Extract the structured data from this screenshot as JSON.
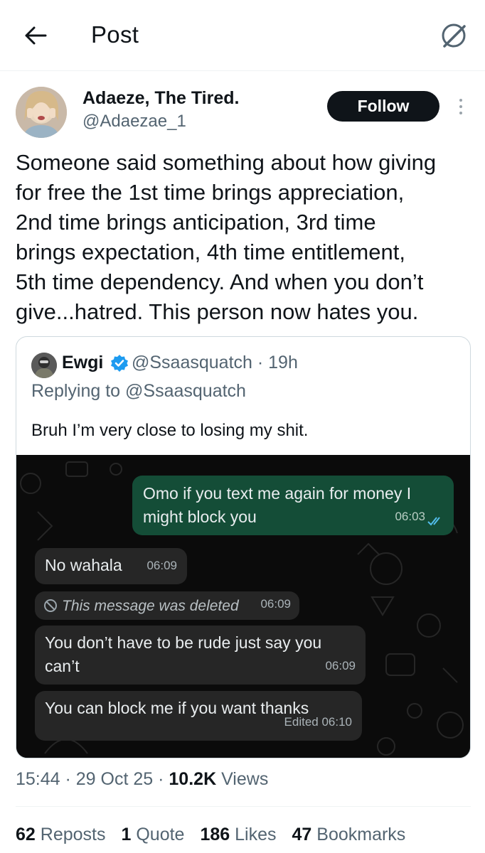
{
  "header": {
    "title": "Post"
  },
  "author": {
    "name": "Adaeze, The Tired.",
    "handle": "@Adaezae_1",
    "follow_label": "Follow"
  },
  "post": {
    "text": "Someone said something about how giving\nfor free the 1st time brings appreciation,\n2nd time brings anticipation, 3rd time\nbrings expectation, 4th time entitlement,\n5th time dependency. And when you don’t\ngive...hatred. This person now hates you."
  },
  "quote": {
    "name": "Ewgi",
    "handle_time": "@Ssaasquatch · 19h",
    "replying": "Replying to @Ssaasquatch",
    "text": "Bruh I’m very close to losing my shit.",
    "chat": {
      "outgoing": {
        "text": "Omo if you text me again for money I might block you",
        "time": "06:03"
      },
      "msg1": {
        "text": "No wahala",
        "time": "06:09"
      },
      "msg2": {
        "text": "This message was deleted",
        "time": "06:09"
      },
      "msg3": {
        "text": "You don’t have to be rude just say you can’t",
        "time": "06:09"
      },
      "msg4": {
        "text": "You can block me if you want thanks",
        "time": "Edited 06:10"
      }
    }
  },
  "meta": {
    "time": "15:44",
    "date": "29 Oct 25",
    "views_count": "10.2K",
    "views_label": "Views"
  },
  "stats": {
    "reposts_count": "62",
    "reposts_label": "Reposts",
    "quotes_count": "1",
    "quotes_label": "Quote",
    "likes_count": "186",
    "likes_label": "Likes",
    "bookmarks_count": "47",
    "bookmarks_label": "Bookmarks"
  },
  "colors": {
    "follow_bg": "#0f1419",
    "verified": "#1d9bf0",
    "outgoing_bubble": "#144d37",
    "incoming_bubble": "#262626",
    "chat_bg": "#0b0b0b"
  },
  "icons": {
    "back": "arrow-left-icon",
    "grok": "grok-icon",
    "more": "more-vertical-icon",
    "verified": "verified-badge-icon",
    "deleted": "blocked-circle-icon",
    "read": "double-check-icon"
  }
}
